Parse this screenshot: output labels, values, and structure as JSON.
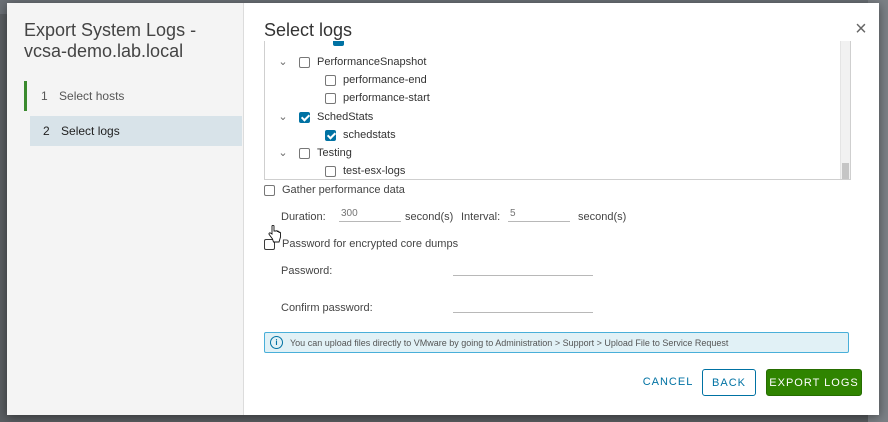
{
  "wizard": {
    "title": "Export System Logs - vcsa-demo.lab.local",
    "steps": [
      {
        "num": "1",
        "label": "Select hosts"
      },
      {
        "num": "2",
        "label": "Select logs"
      }
    ]
  },
  "page": {
    "title": "Select logs",
    "close_icon": "close-icon"
  },
  "tree": [
    {
      "label": "PerformanceSnapshot",
      "checked": false
    },
    {
      "label": "performance-end",
      "checked": false
    },
    {
      "label": "performance-start",
      "checked": false
    },
    {
      "label": "SchedStats",
      "checked": true
    },
    {
      "label": "schedstats",
      "checked": true
    },
    {
      "label": "Testing",
      "checked": false
    },
    {
      "label": "test-esx-logs",
      "checked": false
    }
  ],
  "options": {
    "gather_perf": {
      "label": "Gather performance data",
      "checked": false
    },
    "duration": {
      "label": "Duration:",
      "placeholder": "300",
      "unit": "second(s)"
    },
    "interval": {
      "label": "Interval:",
      "placeholder": "5",
      "unit": "second(s)"
    },
    "encrypt": {
      "label": "Password for encrypted core dumps",
      "checked": false
    },
    "password": {
      "label": "Password:"
    },
    "confirm_password": {
      "label": "Confirm password:"
    }
  },
  "info": {
    "message": "You can upload files directly to VMware by going to Administration > Support > Upload File to Service Request"
  },
  "buttons": {
    "cancel": "CANCEL",
    "back": "BACK",
    "export": "EXPORT LOGS"
  },
  "colors": {
    "accent": "#0072a3",
    "primary_button": "#2f8400",
    "active_step": "#3a8a2e"
  }
}
